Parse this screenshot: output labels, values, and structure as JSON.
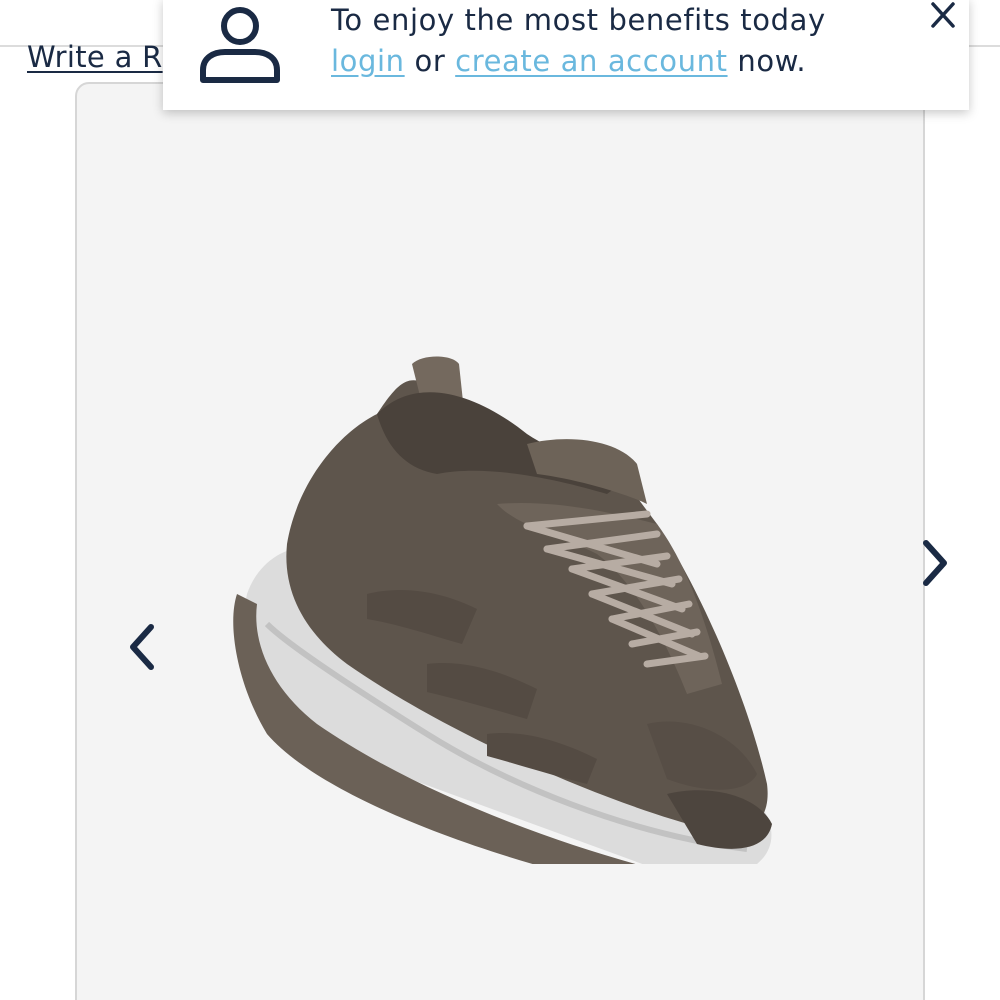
{
  "review": {
    "write_label": "Write a R"
  },
  "login_banner": {
    "message": "To enjoy the most benefits today",
    "login_label": "login",
    "or_text": " or ",
    "create_account_label": "create an account",
    "suffix_text": " now.",
    "link_color": "#6ab8de",
    "text_color": "#1a2a44",
    "icons": {
      "user": "user-icon",
      "close": "close-icon"
    }
  },
  "gallery": {
    "background": "#f4f4f4",
    "icons": {
      "prev": "chevron-left-icon",
      "next": "chevron-right-icon"
    }
  }
}
